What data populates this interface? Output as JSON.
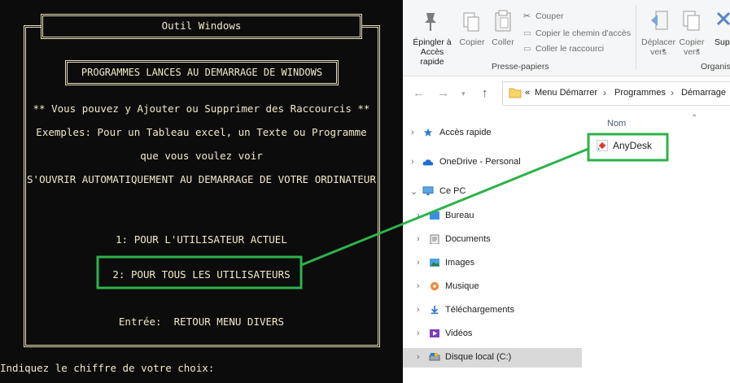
{
  "console": {
    "title": "Outil Windows",
    "heading": "PROGRAMMES LANCES AU DEMARRAGE DE WINDOWS",
    "lines": [
      "** Vous pouvez y Ajouter ou Supprimer des Raccourcis **",
      "Exemples: Pour un Tableau excel, un Texte ou Programme",
      "que vous voulez voir",
      "S'OUVRIR AUTOMATIQUEMENT AU DEMARRAGE DE VOTRE ORDINATEUR"
    ],
    "options": [
      "1: POUR L'UTILISATEUR ACTUEL",
      "2: POUR TOUS LES UTILISATEURS",
      "Entrée:  RETOUR MENU DIVERS"
    ],
    "prompt": "Indiquez le chiffre de votre choix:"
  },
  "ribbon": {
    "pin": "Épingler à Accès rapide",
    "copy": "Copier",
    "paste": "Coller",
    "cut": "Couper",
    "copy_path": "Copier le chemin d'accès",
    "paste_shortcut": "Coller le raccourci",
    "group_clipboard": "Presse-papiers",
    "move_to": "Déplacer vers",
    "copy_to": "Copier vers",
    "delete_partial": "Sup",
    "group_organize": "Organis"
  },
  "address": {
    "overflow": "«",
    "crumbs": [
      "Menu Démarrer",
      "Programmes",
      "Démarrage"
    ]
  },
  "nav": {
    "items": [
      {
        "label": "Accès rapide",
        "icon": "star-icon"
      },
      {
        "label": "OneDrive - Personal",
        "icon": "cloud-icon"
      },
      {
        "label": "Ce PC",
        "icon": "monitor-icon"
      },
      {
        "label": "Bureau",
        "icon": "desktop-folder-icon"
      },
      {
        "label": "Documents",
        "icon": "documents-icon"
      },
      {
        "label": "Images",
        "icon": "images-icon"
      },
      {
        "label": "Musique",
        "icon": "music-icon"
      },
      {
        "label": "Téléchargements",
        "icon": "download-icon"
      },
      {
        "label": "Vidéos",
        "icon": "video-icon"
      },
      {
        "label": "Disque local (C:)",
        "icon": "drive-icon"
      }
    ]
  },
  "content": {
    "column_name": "Nom",
    "files": [
      {
        "name": "AnyDesk",
        "icon": "anydesk-icon"
      }
    ]
  },
  "colors": {
    "console_bg": "#0c0c0c",
    "console_text": "#f2e9c9",
    "highlight": "#2db24a",
    "selection": "#d9d9d9",
    "anydesk_red": "#e23a2f"
  }
}
